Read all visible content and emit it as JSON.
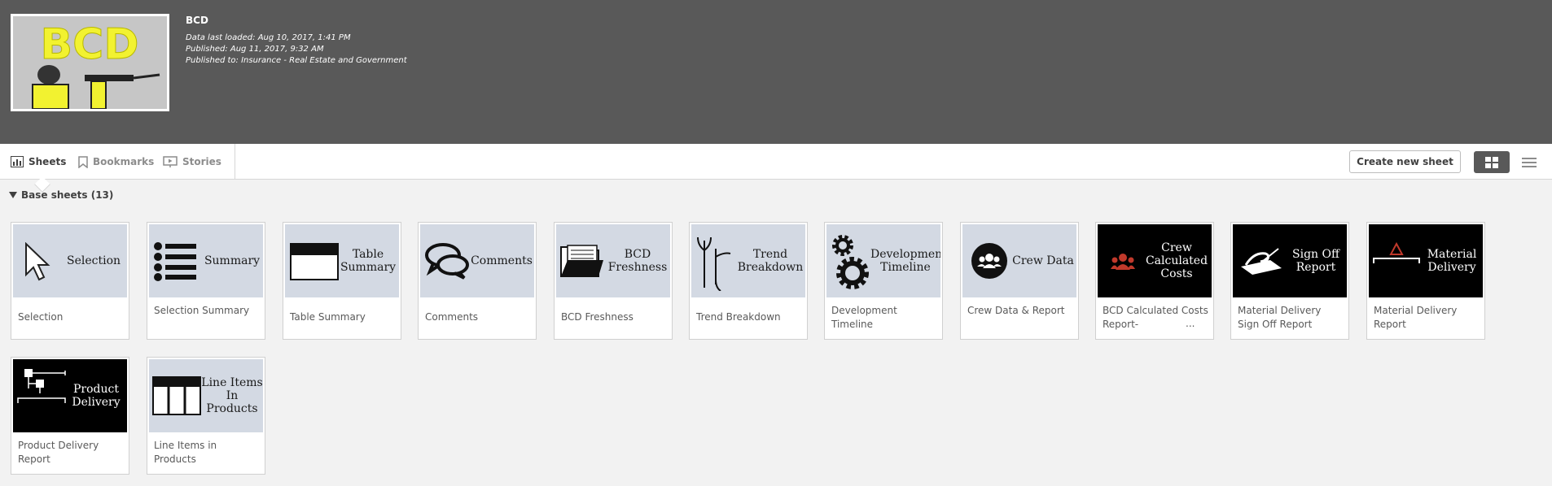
{
  "app": {
    "title": "BCD",
    "thumbnail_text": "BCD",
    "meta": [
      "Data last loaded: Aug 10, 2017, 1:41 PM",
      "Published: Aug 11, 2017, 9:32 AM",
      "Published to: Insurance - Real Estate and Government"
    ]
  },
  "tabs": [
    {
      "label": "Sheets",
      "icon": "chart-icon",
      "active": true
    },
    {
      "label": "Bookmarks",
      "icon": "bookmark-icon",
      "active": false
    },
    {
      "label": "Stories",
      "icon": "presentation-icon",
      "active": false
    }
  ],
  "toolbar": {
    "create_new_sheet": "Create new sheet",
    "grid_view_icon": "grid-icon",
    "list_view_icon": "list-icon"
  },
  "section": {
    "label": "Base sheets (13)"
  },
  "colors": {
    "header_bg": "#595959",
    "thumb_bg": "#d3d9e3",
    "accent_red": "#c0392b"
  },
  "sheets": [
    {
      "thumb_title": "Selection",
      "label": "Selection",
      "icon": "cursor-icon"
    },
    {
      "thumb_title": "Summary",
      "label": "Selection Summary",
      "icon": "list-icon"
    },
    {
      "thumb_title": "Table Summary",
      "label": "Table Summary",
      "icon": "table-icon"
    },
    {
      "thumb_title": "Comments",
      "label": "Comments",
      "icon": "speech-bubbles-icon"
    },
    {
      "thumb_title": "BCD Freshness",
      "label": "BCD Freshness",
      "icon": "folder-icon"
    },
    {
      "thumb_title": "Trend Breakdown",
      "label": "Trend Breakdown",
      "icon": "branch-icon"
    },
    {
      "thumb_title": "Development Timeline",
      "label": "Development Timeline",
      "icon": "gears-icon"
    },
    {
      "thumb_title": "Crew Data",
      "label": "Crew Data & Report",
      "icon": "people-icon"
    },
    {
      "thumb_title": "Crew Calculated Costs",
      "label": "BCD Calculated Costs Report-",
      "ellipsis": "...",
      "icon": "people-red-icon"
    },
    {
      "thumb_title": "Sign Off Report",
      "label": "Material Delivery Sign Off Report",
      "icon": "signing-hand-icon"
    },
    {
      "thumb_title": "Material Delivery",
      "label": "Material Delivery Report",
      "icon": "delta-icon"
    },
    {
      "thumb_title": "Product Delivery",
      "label": "Product Delivery Report",
      "icon": "hierarchy-icon"
    },
    {
      "thumb_title": "Line Items In Products",
      "label": "Line Items in Products",
      "icon": "columns-table-icon"
    }
  ]
}
